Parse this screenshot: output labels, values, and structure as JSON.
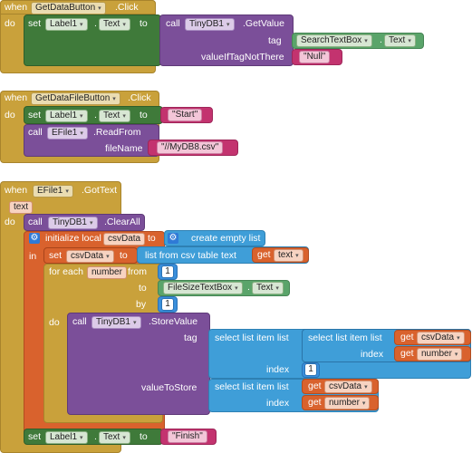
{
  "blocks": {
    "b1": {
      "when": "when",
      "event_comp": "GetDataButton",
      "event": ".Click",
      "do": "do",
      "set": "set",
      "label": "Label1",
      "prop": "Text",
      "to": "to",
      "call": "call",
      "db": "TinyDB1",
      "method": ".GetValue",
      "tag_label": "tag",
      "tag_comp": "SearchTextBox",
      "tag_prop": "Text",
      "vitnt_label": "valueIfTagNotThere",
      "null_value": "Null"
    },
    "b2": {
      "when": "when",
      "event_comp": "GetDataFileButton",
      "event": ".Click",
      "do": "do",
      "set": "set",
      "label": "Label1",
      "prop": "Text",
      "to": "to",
      "start_value": "Start",
      "call": "call",
      "file_comp": "EFile1",
      "method": ".ReadFrom",
      "filename_label": "fileName",
      "filename_value": "//MyDB8.csv"
    },
    "b3": {
      "when": "when",
      "event_comp": "EFile1",
      "event": ".GotText",
      "param": "text",
      "do": "do",
      "call": "call",
      "db": "TinyDB1",
      "clear": ".ClearAll",
      "init_local": "initialize local",
      "var_csv": "csvData",
      "to": "to",
      "create_empty": "create empty list",
      "in": "in",
      "set": "set",
      "lfct": "list from csv table  text",
      "get": "get",
      "text_var": "text",
      "for_each": "for each",
      "num_var": "number",
      "from": "from",
      "from_val": "1",
      "to_label": "to",
      "fstb": "FileSizeTextBox",
      "fstb_prop": "Text",
      "by": "by",
      "by_val": "1",
      "call2": "call",
      "db2": "TinyDB1",
      "store": ".StoreValue",
      "tag": "tag",
      "sli": "select list item  list",
      "index": "index",
      "index_val": "1",
      "vts": "valueToStore",
      "csv_get": "csvData",
      "number_get": "number",
      "set_final": "set",
      "label": "Label1",
      "prop": "Text",
      "finish_value": "Finish"
    }
  },
  "colors": {
    "event": "#c9a13b",
    "set": "#3f7a3a",
    "call": "#7b4f99",
    "text": "#c3336f",
    "var": "#d9622d",
    "list": "#3f9ed8",
    "component": "#5aa46a"
  }
}
